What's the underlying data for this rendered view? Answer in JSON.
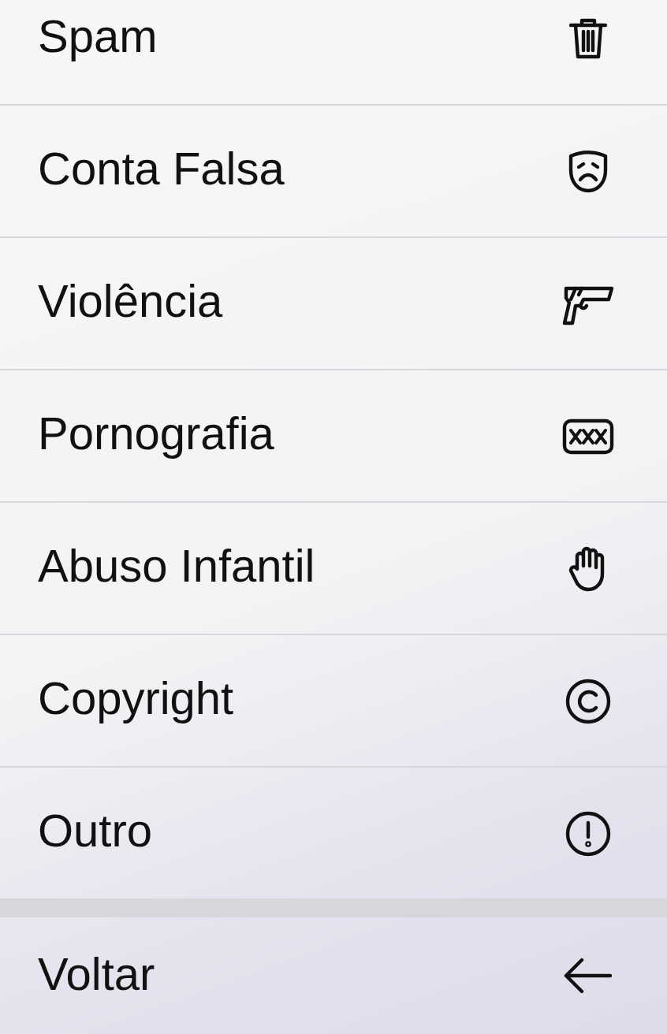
{
  "menu_items": [
    {
      "label": "Spam"
    },
    {
      "label": "Conta Falsa"
    },
    {
      "label": "Violência"
    },
    {
      "label": "Pornografia"
    },
    {
      "label": "Abuso Infantil"
    },
    {
      "label": "Copyright"
    },
    {
      "label": "Outro"
    }
  ],
  "back_item": {
    "label": "Voltar"
  }
}
